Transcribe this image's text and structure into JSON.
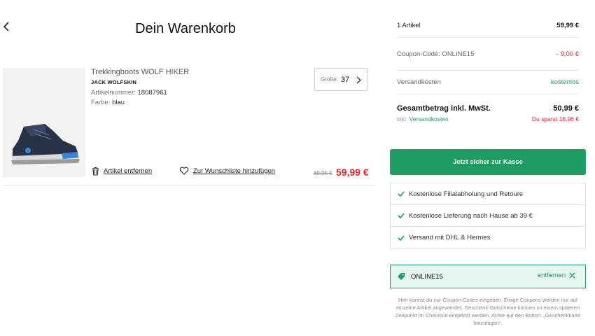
{
  "header": {
    "title": "Dein Warenkorb",
    "back_icon": "chevron-left-icon"
  },
  "cart": {
    "items": [
      {
        "name": "Trekkingboots WOLF HIKER",
        "brand": "JACK WOLFSKIN",
        "article_label": "Artikelnummer:",
        "article_number": "18087961",
        "color_label": "Farbe:",
        "color": "blau",
        "size_label": "Größe:",
        "size": "37",
        "remove_label": "Artikel entfernen",
        "wishlist_label": "Zur Wunschliste hinzufügen",
        "old_price": "69,95 €",
        "price": "59,99 €"
      }
    ]
  },
  "summary": {
    "items_label": "1 Artikel",
    "items_value": "59,99 €",
    "coupon_label": "Coupon-Code: ONLINE15",
    "coupon_value": "- 9,00 €",
    "shipping_label": "Versandkosten",
    "shipping_value": "kostenlos",
    "total_label": "Gesamtbetrag inkl. MwSt.",
    "total_value": "50,99 €",
    "incl_prefix": "inkl.",
    "incl_link": "Versandkosten",
    "savings": "Du sparst 18,96 €"
  },
  "checkout": {
    "button_label": "Jetzt sicher zur Kasse"
  },
  "benefits": [
    "Kostenlose Filialabholung und Retoure",
    "Kostenlose Lieferung nach Hause ab 39 €",
    "Versand mit DHL & Hermes"
  ],
  "coupon": {
    "code": "ONLINE15",
    "remove_label": "entfernen",
    "hint": "Hier kannst du nur Coupon-Codes eingeben. Einige Coupons werden nur auf einzelne Artikel angewendet. Geschenk-Gutscheine können zu einem späteren Zeitpunkt im Checkout eingelöst werden. Achte auf den Button: „Geschenkkarte hinzufügen“."
  },
  "colors": {
    "accent_green": "#1c9e62",
    "price_red": "#e5252f"
  }
}
